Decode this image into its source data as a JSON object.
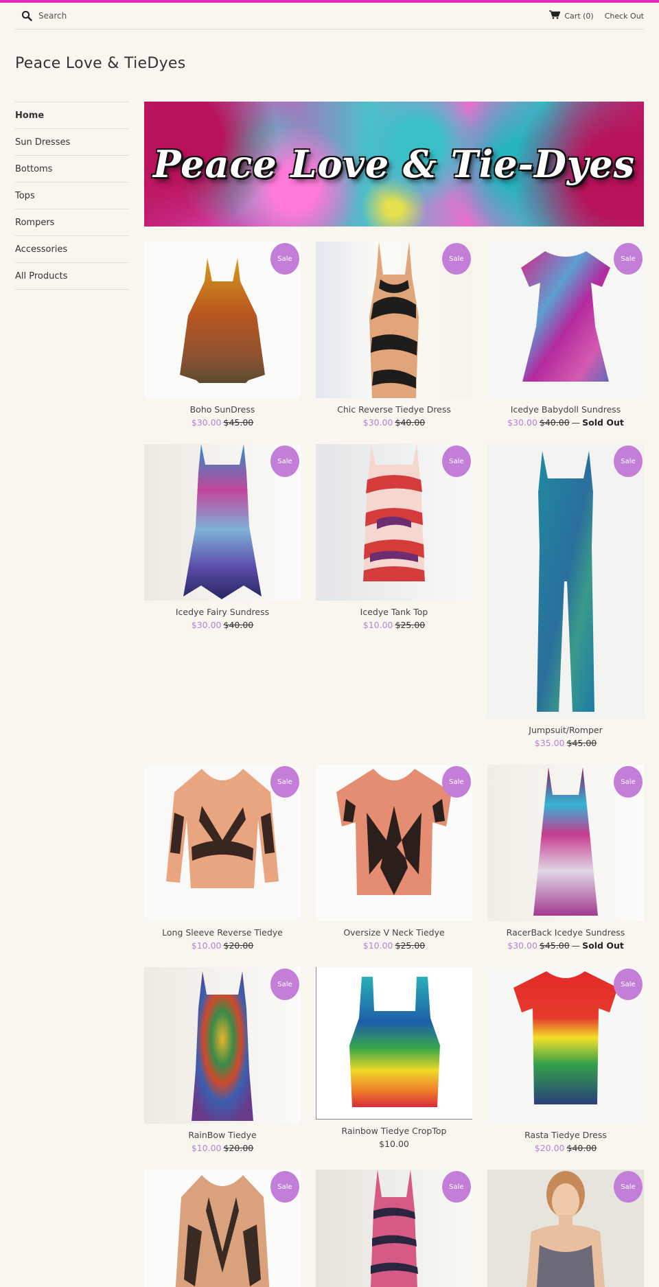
{
  "header": {
    "search_placeholder": "Search",
    "cart_label": "Cart (0)",
    "checkout_label": "Check Out",
    "accent_color": "#e02bc1"
  },
  "site": {
    "title": "Peace Love & TieDyes"
  },
  "sidebar": {
    "items": [
      {
        "label": "Home",
        "active": true
      },
      {
        "label": "Sun Dresses"
      },
      {
        "label": "Bottoms"
      },
      {
        "label": "Tops"
      },
      {
        "label": "Rompers"
      },
      {
        "label": "Accessories"
      },
      {
        "label": "All Products"
      }
    ]
  },
  "banner": {
    "text": "Peace Love & Tie-Dyes"
  },
  "products": [
    {
      "title": "Boho SunDress",
      "sale_price": "$30.00",
      "compare_price": "$45.00",
      "badge": "Sale"
    },
    {
      "title": "Chic Reverse Tiedye Dress",
      "sale_price": "$30.00",
      "compare_price": "$40.00",
      "badge": "Sale"
    },
    {
      "title": "Icedye Babydoll Sundress",
      "sale_price": "$30.00",
      "compare_price": "$40.00",
      "separator": "—",
      "status": "Sold Out",
      "badge": "Sale"
    },
    {
      "title": "Icedye Fairy Sundress",
      "sale_price": "$30.00",
      "compare_price": "$40.00",
      "badge": "Sale"
    },
    {
      "title": "Icedye Tank Top",
      "sale_price": "$10.00",
      "compare_price": "$25.00",
      "badge": "Sale"
    },
    {
      "title": "Jumpsuit/Romper",
      "sale_price": "$35.00",
      "compare_price": "$45.00",
      "badge": "Sale"
    },
    {
      "title": "Long Sleeve Reverse Tiedye",
      "sale_price": "$10.00",
      "compare_price": "$20.00",
      "badge": "Sale"
    },
    {
      "title": "Oversize V Neck Tiedye",
      "sale_price": "$10.00",
      "compare_price": "$25.00",
      "badge": "Sale"
    },
    {
      "title": "RacerBack Icedye Sundress",
      "sale_price": "$30.00",
      "compare_price": "$45.00",
      "separator": "—",
      "status": "Sold Out",
      "badge": "Sale"
    },
    {
      "title": "RainBow Tiedye",
      "sale_price": "$10.00",
      "compare_price": "$20.00",
      "badge": "Sale"
    },
    {
      "title": "Rainbow Tiedye CropTop",
      "price": "$10.00"
    },
    {
      "title": "Rasta Tiedye Dress",
      "sale_price": "$20.00",
      "compare_price": "$40.00",
      "badge": "Sale"
    },
    {
      "badge": "Sale"
    },
    {
      "badge": "Sale"
    },
    {
      "badge": "Sale"
    }
  ]
}
